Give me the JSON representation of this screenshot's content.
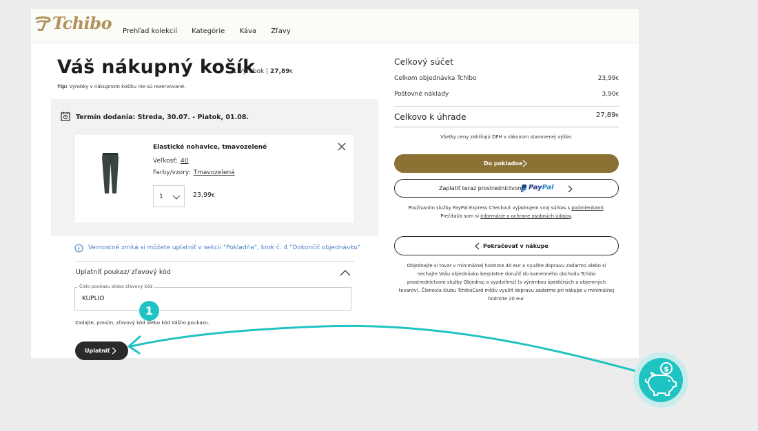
{
  "brand": {
    "logo_text": "Tchibo"
  },
  "nav": {
    "items": [
      "Prehľad kolekcií",
      "Kategórie",
      "Káva",
      "Zľavy"
    ]
  },
  "cart": {
    "title": "Váš nákupný košík",
    "item_count": "1 Výrobok |",
    "total_price": "27,89",
    "currency": "€",
    "tip_label": "Tip:",
    "tip_text": "Výrobky v nákupnom košíku nie sú rezervované.",
    "delivery_text": "Termín dodania: Streda, 30.07. - Piatok, 01.08.",
    "product": {
      "name": "Elastické nohavice, tmavozelené",
      "size_label": "Veľkosť:",
      "size_value": "40",
      "color_label": "Farby/vzory:",
      "color_value": "Tmavozelená",
      "quantity": "1",
      "price": "23,99",
      "currency": "€"
    },
    "loyalty_info": "Vernostné zrnká si môžete uplatniť v sekcii \"Pokladňa\", krok č. 4 \"Dokončiť objednávku\"",
    "voucher": {
      "title": "Uplatniť poukaz/ zľavový kód",
      "input_label": "Číslo poukazu alebo zľavový kód",
      "input_value": "KUPLIO",
      "hint": "Zadajte, prosím, zľavový kód alebo kód Vášho poukazu.",
      "apply_label": "Uplatniť"
    },
    "step_badge": "1"
  },
  "summary": {
    "title": "Celkový súčet",
    "rows": [
      {
        "label": "Celkom objednávka Tchibo",
        "value": "23,99",
        "currency": "€"
      },
      {
        "label": "Poštovné náklady",
        "value": "3,90",
        "currency": "€"
      }
    ],
    "total_label": "Celkovo k úhrade",
    "total_value": "27,89",
    "currency": "€",
    "vat_note": "Všetky ceny zahŕňajú DPH v zákonom stanovenej výške.",
    "checkout_label": "Do pokladne",
    "paypal_label": "Zaplatiť teraz prostredníctvom",
    "paypal_brand_a": "Pay",
    "paypal_brand_b": "Pal",
    "paypal_note_1": "Používaním služby PayPal Express Checkout vyjadrujem svoj súhlas s",
    "paypal_note_link1": "podmienkami",
    "paypal_note_2": "Prečítal/a som si",
    "paypal_note_link2": "informácie o ochrane osobných údajov",
    "continue_label": "Pokračovať v nákupe",
    "shipping_note": "Objednajte si tovar v minimálnej hodnote 40 eur a využite dopravu zadarmo alebo si nechajte Vašu objednávku bezplatne doručiť do kamenného obchodu Tchibo prostredníctvom služby Objednaj a vyzdvihnúť (s výnimkou špedičných a objemných tovarov). Členovia klubu TchiboCard môžu využiť dopravu zadarmo pri nákupe v minimálnej hodnote 20 eur."
  },
  "colors": {
    "gold_button": "#8c7134",
    "teal_accent": "#1fc3c2",
    "link_blue": "#4c7fc0"
  },
  "icons": [
    "calendar-icon",
    "close-icon",
    "chevron-down-icon",
    "chevron-up-icon",
    "chevron-right-icon",
    "chevron-left-icon",
    "info-icon",
    "piggy-bank-icon",
    "paypal-logo"
  ]
}
